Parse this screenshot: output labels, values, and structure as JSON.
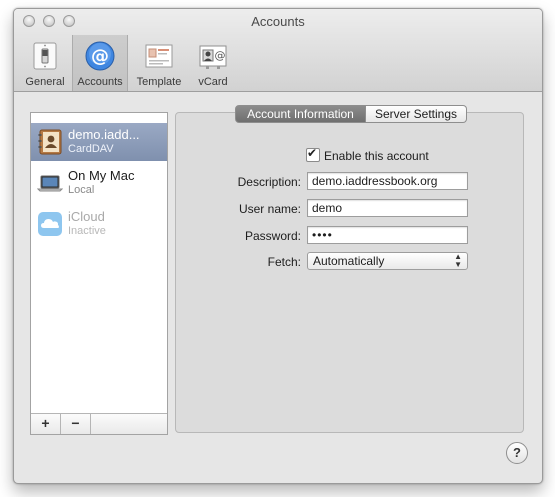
{
  "window": {
    "title": "Accounts"
  },
  "toolbar": {
    "general": "General",
    "accounts": "Accounts",
    "template": "Template",
    "vcard": "vCard"
  },
  "sidebar": {
    "accounts": [
      {
        "name": "demo.iadd...",
        "sub": "CardDAV",
        "selected": true,
        "icon": "contacts-book-icon"
      },
      {
        "name": "On My Mac",
        "sub": "Local",
        "selected": false,
        "icon": "laptop-icon"
      },
      {
        "name": "iCloud",
        "sub": "Inactive",
        "selected": false,
        "icon": "icloud-icon"
      }
    ],
    "add_label": "+",
    "remove_label": "−"
  },
  "tabs": {
    "account_information": "Account Information",
    "server_settings": "Server Settings",
    "selected": "Account Information"
  },
  "form": {
    "enable_label": "Enable this account",
    "enabled": true,
    "description_label": "Description:",
    "description_value": "demo.iaddressbook.org",
    "username_label": "User name:",
    "username_value": "demo",
    "password_label": "Password:",
    "password_value": "••••",
    "fetch_label": "Fetch:",
    "fetch_value": "Automatically"
  },
  "help": {
    "label": "?"
  },
  "colors": {
    "selection": "#8d9db9",
    "window_bg": "#e6e6e6",
    "tab_selected": "#7e7e7e"
  }
}
